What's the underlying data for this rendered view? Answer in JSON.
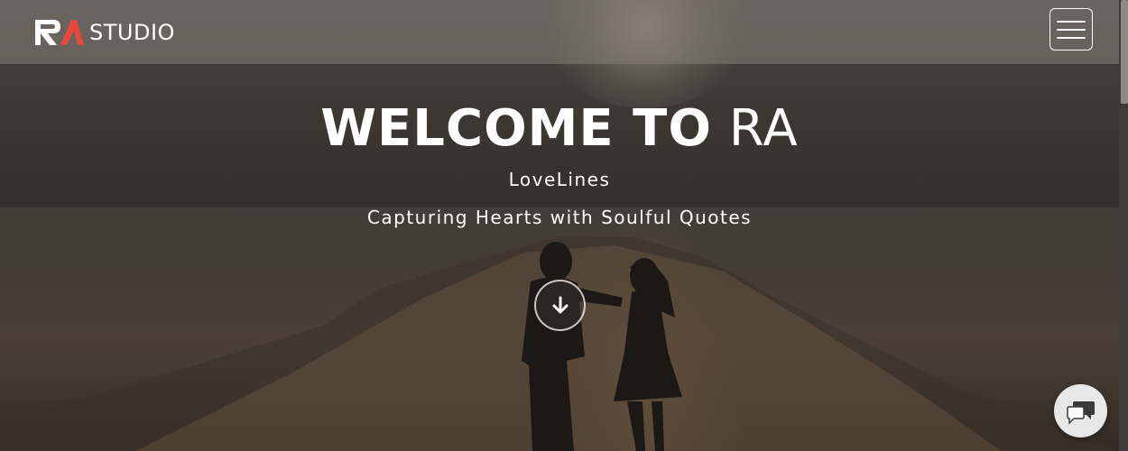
{
  "brand": {
    "logo_mark": "RA",
    "name": "STUDIO",
    "accent_color": "#e8473f"
  },
  "nav": {
    "menu_icon": "hamburger-menu-icon"
  },
  "hero": {
    "headline_bold": "WELCOME TO",
    "headline_light": "RA",
    "subtitle": "LoveLines",
    "tagline": "Capturing Hearts with Soulful Quotes",
    "scroll_icon": "arrow-down-icon"
  },
  "chat": {
    "icon": "chat-bubbles-icon"
  }
}
